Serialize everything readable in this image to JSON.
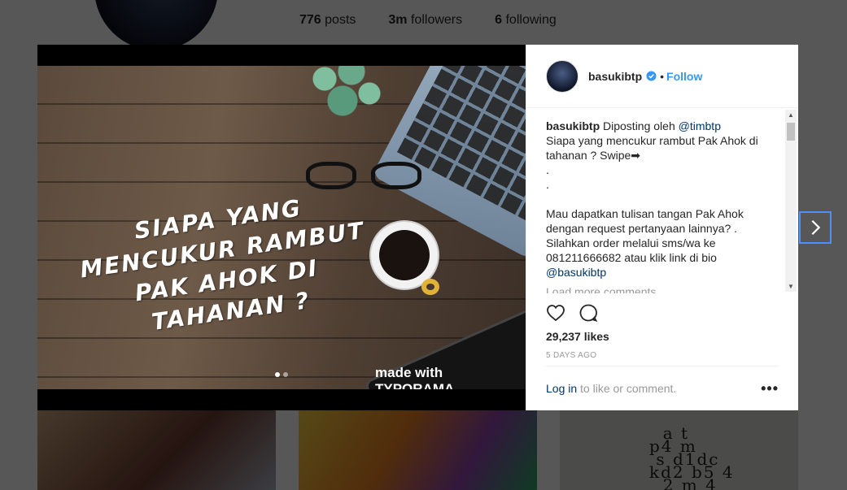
{
  "profile": {
    "stats": [
      {
        "value": "776",
        "label": "posts"
      },
      {
        "value": "3m",
        "label": "followers"
      },
      {
        "value": "6",
        "label": "following"
      }
    ]
  },
  "post": {
    "image_headline": "SIAPA YANG MENCUKUR RAMBUT PAK AHOK DI TAHANAN ?",
    "image_watermark": "made with TYPORAMA",
    "carousel_dots": 2,
    "carousel_active": 1,
    "username": "basukibtp",
    "verified": true,
    "bullet": "•",
    "follow_label": "Follow",
    "caption": {
      "user": "basukibtp",
      "prefix": "Diposting oleh",
      "mention": "@timbtp",
      "text": "Siapa yang mencukur rambut Pak Ahok di tahanan ? Swipe➡\n.\n.\n\nMau dapatkan tulisan tangan Pak Ahok dengan request pertanyaan lainnya? . Silahkan order melalui sms/wa ke 081211666682 atau klik link di bio",
      "bio_mention": "@basukibtp"
    },
    "load_more": "Load more comments",
    "likes": "29,237 likes",
    "date": "5 DAYS AGO",
    "login_link": "Log in",
    "login_text": "to like or comment.",
    "more_label": "•••"
  },
  "icons": {
    "like": "heart-icon",
    "comment": "comment-icon",
    "next": "chevron-right-icon",
    "verified": "verified-badge-icon"
  },
  "colors": {
    "accent": "#3897f0",
    "link": "#003569",
    "muted": "#999999",
    "text": "#262626"
  }
}
